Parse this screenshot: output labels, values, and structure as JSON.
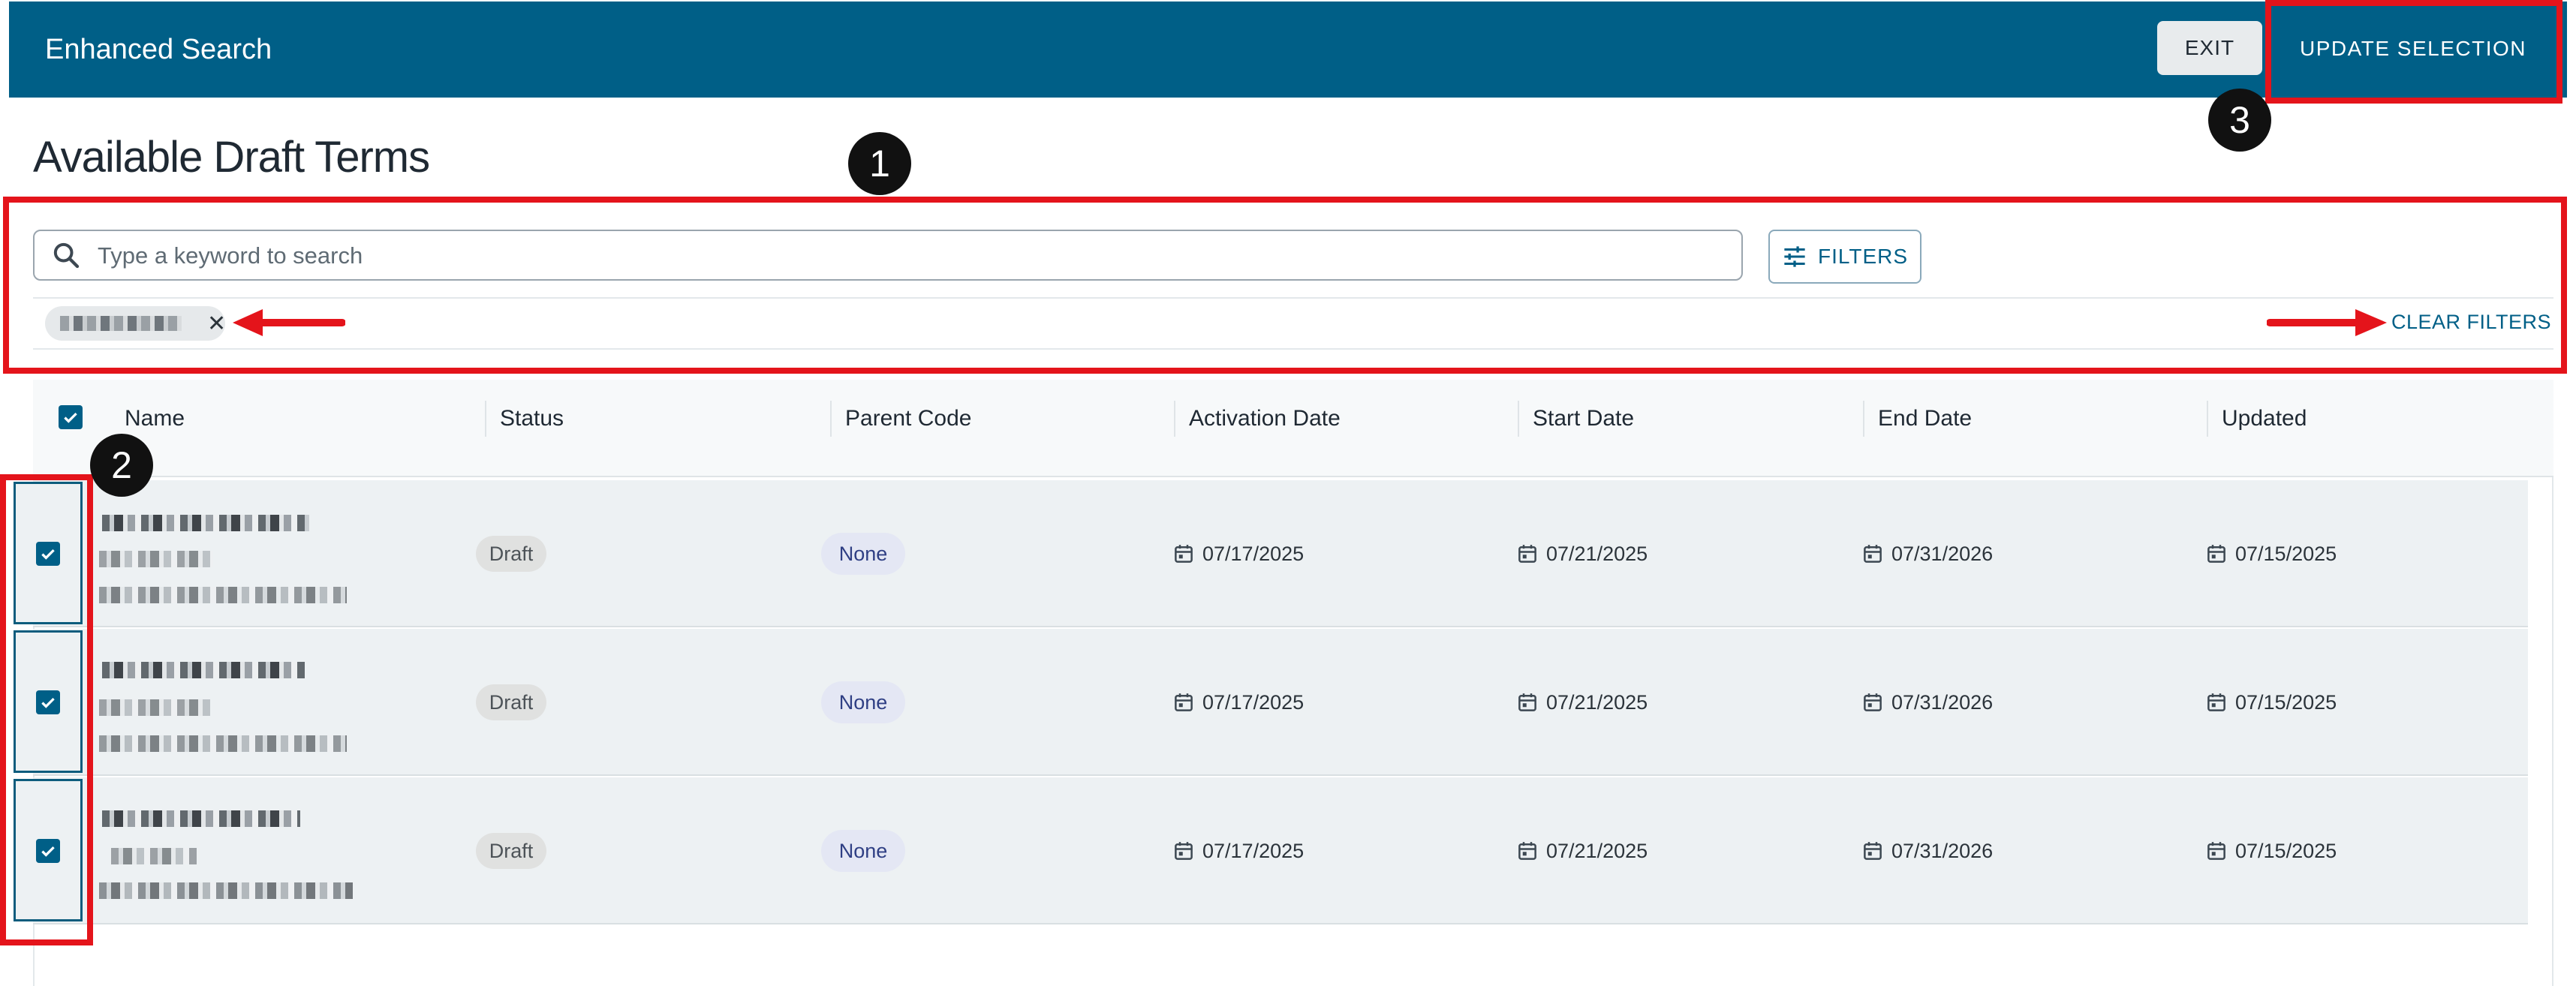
{
  "header": {
    "app_title": "Enhanced Search",
    "exit_label": "EXIT",
    "update_label": "UPDATE SELECTION"
  },
  "page": {
    "title": "Available Draft Terms"
  },
  "search": {
    "placeholder": "Type a keyword to search",
    "value": ""
  },
  "filters": {
    "button_label": "FILTERS",
    "clear_label": "CLEAR FILTERS"
  },
  "table": {
    "columns": [
      "Name",
      "Status",
      "Parent Code",
      "Activation Date",
      "Start Date",
      "End Date",
      "Updated"
    ],
    "rows": [
      {
        "checked": true,
        "status": "Draft",
        "parent_code": "None",
        "activation_date": "07/17/2025",
        "start_date": "07/21/2025",
        "end_date": "07/31/2026",
        "updated": "07/15/2025"
      },
      {
        "checked": true,
        "status": "Draft",
        "parent_code": "None",
        "activation_date": "07/17/2025",
        "start_date": "07/21/2025",
        "end_date": "07/31/2026",
        "updated": "07/15/2025"
      },
      {
        "checked": true,
        "status": "Draft",
        "parent_code": "None",
        "activation_date": "07/17/2025",
        "start_date": "07/21/2025",
        "end_date": "07/31/2026",
        "updated": "07/15/2025"
      }
    ]
  },
  "annotations": [
    "1",
    "2",
    "3"
  ],
  "colors": {
    "header_bg": "#005f87",
    "accent": "#005f87",
    "annotation_red": "#e4141b"
  }
}
